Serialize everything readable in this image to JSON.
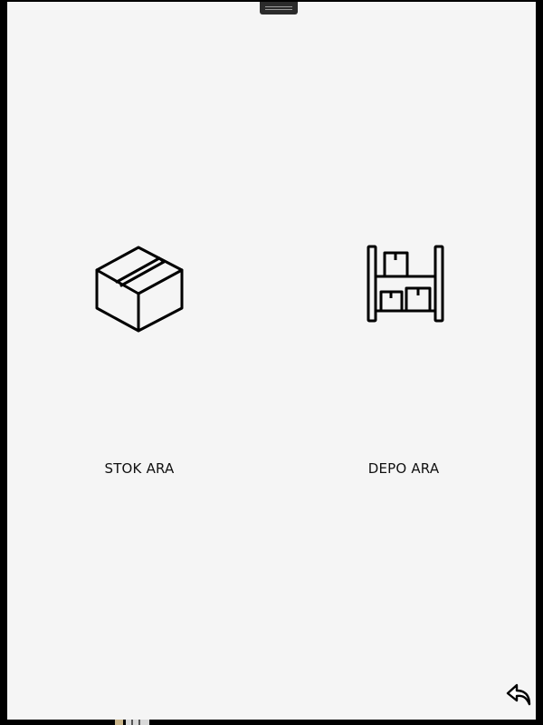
{
  "tiles": {
    "stock": {
      "label": "STOK ARA",
      "icon": "cardboard-box-icon"
    },
    "depot": {
      "label": "DEPO ARA",
      "icon": "warehouse-shelf-icon"
    }
  },
  "controls": {
    "back_icon": "undo-arrow-icon",
    "grabber_icon": "drag-handle-icon"
  },
  "colors": {
    "background": "#f5f5f5",
    "frame": "#000000",
    "icon_stroke": "#000000"
  }
}
